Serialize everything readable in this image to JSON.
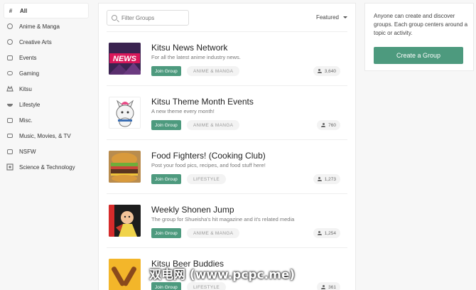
{
  "sidebar": {
    "items": [
      {
        "label": "All",
        "icon": "hash-icon"
      },
      {
        "label": "Anime & Manga",
        "icon": "face-icon"
      },
      {
        "label": "Creative Arts",
        "icon": "palette-icon"
      },
      {
        "label": "Events",
        "icon": "calendar-icon"
      },
      {
        "label": "Gaming",
        "icon": "gamepad-icon"
      },
      {
        "label": "Kitsu",
        "icon": "kitsu-icon"
      },
      {
        "label": "Lifestyle",
        "icon": "bowl-icon"
      },
      {
        "label": "Misc.",
        "icon": "box-icon"
      },
      {
        "label": "Music, Movies, & TV",
        "icon": "tv-icon"
      },
      {
        "label": "NSFW",
        "icon": "nsfw-icon"
      },
      {
        "label": "Science & Technology",
        "icon": "chip-icon"
      }
    ]
  },
  "search": {
    "placeholder": "Filter Groups"
  },
  "sort": {
    "label": "Featured"
  },
  "groups": [
    {
      "title": "Kitsu News Network",
      "desc": "For all the latest anime industry news.",
      "join": "Join Group",
      "tag": "ANIME & MANGA",
      "members": "3,640"
    },
    {
      "title": "Kitsu Theme Month Events",
      "desc": "A new theme every month!",
      "join": "Join Group",
      "tag": "ANIME & MANGA",
      "members": "760"
    },
    {
      "title": "Food Fighters! (Cooking Club)",
      "desc": "Post your food pics, recipes, and food stuff here!",
      "join": "Join Group",
      "tag": "LIFESTYLE",
      "members": "1,273"
    },
    {
      "title": "Weekly Shonen Jump",
      "desc": "The group for Shueisha's hit magazine and it's related media",
      "join": "Join Group",
      "tag": "ANIME & MANGA",
      "members": "1,254"
    },
    {
      "title": "Kitsu Beer Buddies",
      "desc": "",
      "join": "Join Group",
      "tag": "LIFESTYLE",
      "members": "361"
    }
  ],
  "thumb_text": {
    "news": "NEWS"
  },
  "info": {
    "text": "Anyone can create and discover groups. Each group centers around a topic or activity.",
    "button": "Create a Group"
  },
  "watermark": "双电网 (www.pcpc.me)",
  "colors": {
    "accent": "#4d9a7e",
    "background": "#f7f7f7"
  }
}
